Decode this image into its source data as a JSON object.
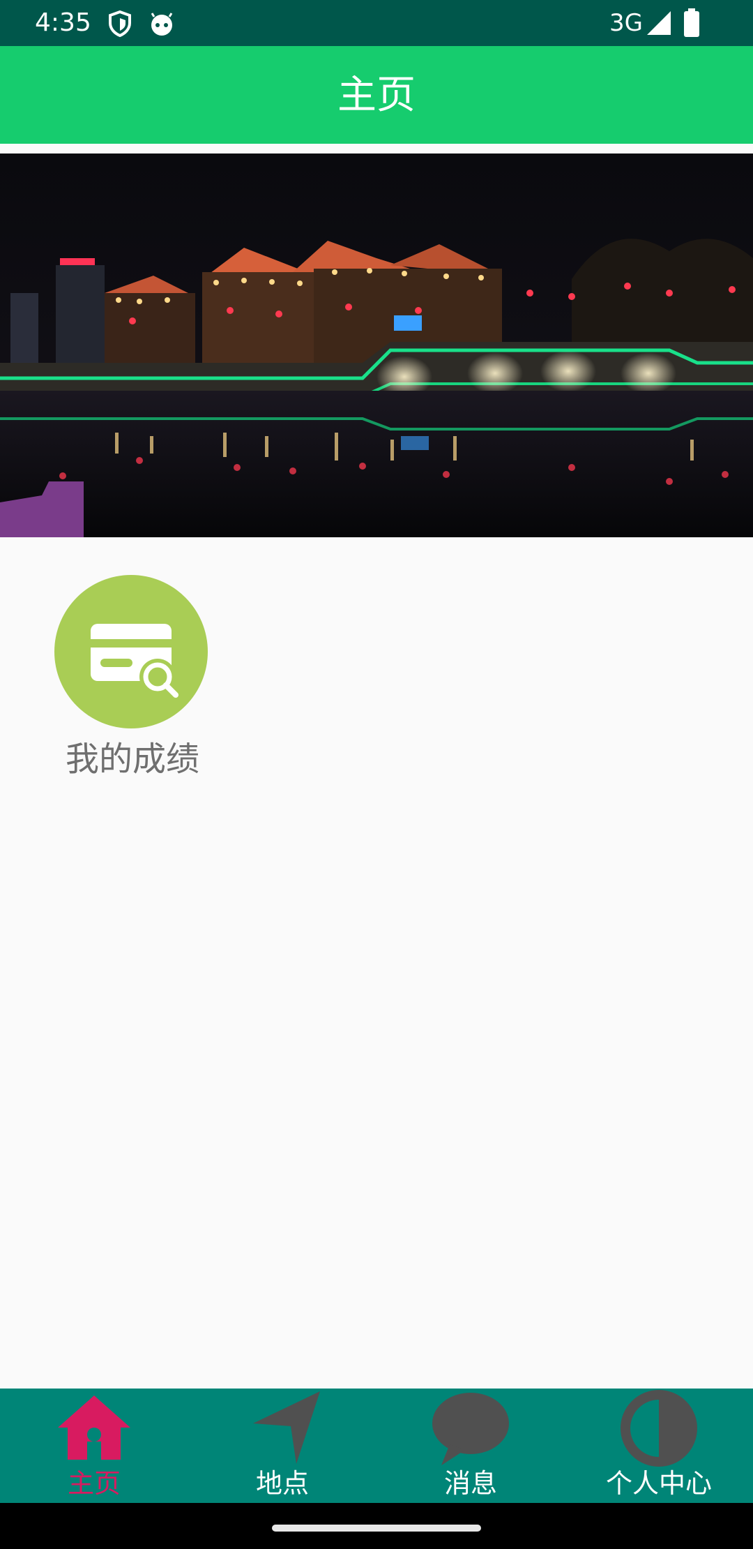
{
  "status_bar": {
    "time": "4:35",
    "network": "3G",
    "icons": [
      "shield-icon",
      "android-face-icon",
      "signal-icon",
      "battery-icon"
    ]
  },
  "app_bar": {
    "title": "主页",
    "color": "#16cc6e"
  },
  "banner": {
    "description_icon": "night-scene-image"
  },
  "tiles": [
    {
      "label": "我的成绩",
      "icon": "card-search-icon",
      "color": "#a9cd55"
    }
  ],
  "bottom_nav": {
    "active_index": 0,
    "active_color": "#d81b60",
    "items": [
      {
        "label": "主页",
        "icon": "home-icon"
      },
      {
        "label": "地点",
        "icon": "navigation-arrow-icon"
      },
      {
        "label": "消息",
        "icon": "chat-bubble-icon"
      },
      {
        "label": "个人中心",
        "icon": "contrast-circle-icon"
      }
    ]
  },
  "colors": {
    "status_bar": "#00574b",
    "bottom_nav": "#008577",
    "background": "#fafafa"
  }
}
